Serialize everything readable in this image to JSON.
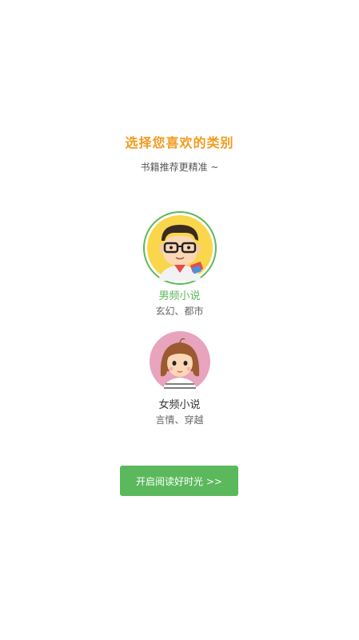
{
  "header": {
    "title": "选择您喜欢的类别",
    "subtitle": "书籍推荐更精准 ~"
  },
  "categories": [
    {
      "name": "男频小说",
      "description": "玄幻、都市",
      "selected": true,
      "icon": "male-avatar-icon"
    },
    {
      "name": "女频小说",
      "description": "言情、穿越",
      "selected": false,
      "icon": "female-avatar-icon"
    }
  ],
  "action": {
    "start_label": "开启阅读好时光 >>"
  },
  "colors": {
    "accent_orange": "#f39a1e",
    "brand_green": "#5cb85c",
    "male_avatar_bg": "#f9d64a",
    "female_avatar_bg": "#e8a3bd"
  }
}
